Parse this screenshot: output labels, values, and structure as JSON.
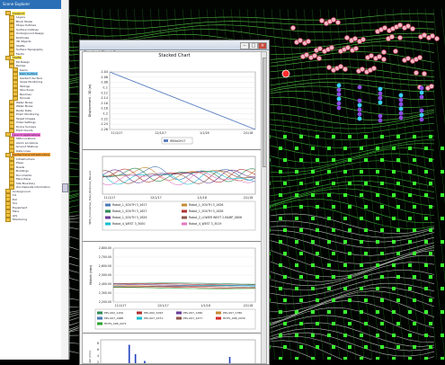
{
  "explorer": {
    "title": "Scene Explorer",
    "items": [
      {
        "label": "Viewport",
        "indent": 1,
        "hl": "#f5e050"
      },
      {
        "label": "Layers",
        "indent": 2
      },
      {
        "label": "Block Model",
        "indent": 2
      },
      {
        "label": "Stope Outlines",
        "indent": 2
      },
      {
        "label": "Surface Outlines",
        "indent": 2
      },
      {
        "label": "Underground Design",
        "indent": 2
      },
      {
        "label": "Drillholes",
        "indent": 2
      },
      {
        "label": "3D Objects",
        "indent": 2
      },
      {
        "label": "Shafts",
        "indent": 2
      },
      {
        "label": "Surface Topography",
        "indent": 2
      },
      {
        "label": "Faults",
        "indent": 2
      },
      {
        "label": "Shafts",
        "indent": 1,
        "hl": "#f5e050"
      },
      {
        "label": "Pit Design",
        "indent": 2
      },
      {
        "label": "Ramps",
        "indent": 2
      },
      {
        "label": "Dams",
        "indent": 3
      },
      {
        "label": "Dam Surface",
        "indent": 3,
        "hl": "#7fd0f5"
      },
      {
        "label": "Geotech Surface",
        "indent": 3
      },
      {
        "label": "Slope Monitoring",
        "indent": 3
      },
      {
        "label": "Tailings",
        "indent": 3
      },
      {
        "label": "Structures",
        "indent": 3
      },
      {
        "label": "Benches",
        "indent": 3
      },
      {
        "label": "Tunnels",
        "indent": 3
      },
      {
        "label": "Water Bores",
        "indent": 2
      },
      {
        "label": "Water Bores",
        "indent": 2
      },
      {
        "label": "Radar Data",
        "indent": 2
      },
      {
        "label": "Prism Monitoring",
        "indent": 2
      },
      {
        "label": "Target Images",
        "indent": 2
      },
      {
        "label": "Video Settings",
        "indent": 2
      },
      {
        "label": "Drone Surveys",
        "indent": 2
      },
      {
        "label": "Point Clouds",
        "indent": 2
      },
      {
        "label": "Launch Applications",
        "indent": 1,
        "hl": "#f06fd8"
      },
      {
        "label": "SMS Locations",
        "indent": 2
      },
      {
        "label": "Alarm Locations",
        "indent": 2
      },
      {
        "label": "Ground Stations",
        "indent": 2
      },
      {
        "label": "Data Lines",
        "indent": 2
      },
      {
        "label": "Geotechnical Infrastructure",
        "indent": 1,
        "hl": "#f5a030"
      },
      {
        "label": "Infrastructure",
        "indent": 2
      },
      {
        "label": "Pipes",
        "indent": 2
      },
      {
        "label": "Roads",
        "indent": 2
      },
      {
        "label": "Buildings",
        "indent": 2
      },
      {
        "label": "Documents",
        "indent": 2
      },
      {
        "label": "Mine Plans",
        "indent": 2
      },
      {
        "label": "Site Boundary",
        "indent": 2
      },
      {
        "label": "Ore Deposits Information",
        "indent": 2
      },
      {
        "label": "Underground",
        "indent": 1
      },
      {
        "label": "Int",
        "indent": 1
      },
      {
        "label": "Ext",
        "indent": 1
      },
      {
        "label": "Scs",
        "indent": 1
      },
      {
        "label": "Equipment",
        "indent": 1
      },
      {
        "label": "Mine",
        "indent": 1
      },
      {
        "label": "GIS",
        "indent": 1
      },
      {
        "label": "Monitoring",
        "indent": 1
      }
    ]
  },
  "chart_window": {
    "title": "Stacked Chart 1",
    "header": "Stacked Chart"
  },
  "chart_data": [
    {
      "type": "line",
      "ylabel": "Displacement - 3D (m)",
      "yticks": [
        "-1.04",
        "-1.06",
        "-1.08",
        "-1.1",
        "-1.12",
        "-1.14",
        "-1.16",
        "-1.18",
        "-1.2",
        "-1.22",
        "-1.24",
        "-1.26"
      ],
      "xticks": [
        "11/1/17",
        "12/1/17",
        "1/1/18",
        "2/1/18"
      ],
      "series": [
        {
          "name": "IRSite2917",
          "color": "#5b7fc4",
          "x": [
            0,
            1
          ],
          "y": [
            -1.03,
            -1.26
          ]
        }
      ],
      "legend": [
        "IRSite2917"
      ]
    },
    {
      "type": "line",
      "ylabel": "SMS_Cumulative_Total_Distance_Moved",
      "xticks": [
        "11/1/17",
        "12/1/17",
        "1/1/18",
        "2/1/18"
      ],
      "legend": [
        {
          "name": "Robot_1_SOUTH 3_1617",
          "color": "#4a7ab5"
        },
        {
          "name": "Robot_1_SOUTH 3_1626",
          "color": "#c78a35"
        },
        {
          "name": "Robot_1_SOUTH 3_1627",
          "color": "#2e8b57"
        },
        {
          "name": "Robot_1_SOUTH 3_1628",
          "color": "#b03030"
        },
        {
          "name": "Robot_1_SOUTH 3_1629",
          "color": "#6a3d9a"
        },
        {
          "name": "Robot_2_LOWER WEST 2-RAMP_0806",
          "color": "#8c564b"
        },
        {
          "name": "Robot_4_WEST 3_3000",
          "color": "#17becf"
        },
        {
          "name": "Robot_4_WEST 3_3019",
          "color": "#e377c2"
        }
      ]
    },
    {
      "type": "line",
      "ylabel": "Historic (mm)",
      "yticks": [
        "2,800.00",
        "2,700.00",
        "2,600.00",
        "2,500.00",
        "2,400.00",
        "2,300.00",
        "2,200.00"
      ],
      "xticks": [
        "11/1/17",
        "12/1/17",
        "1/1/18",
        "2/1/18"
      ],
      "legend": [
        {
          "name": "PPL-002_1100",
          "color": "#2e8b57"
        },
        {
          "name": "PPL-002_1093",
          "color": "#b03030"
        },
        {
          "name": "PPL-007_1280",
          "color": "#6a3d9a"
        },
        {
          "name": "PPL-007_1780",
          "color": "#c78a35"
        },
        {
          "name": "PPL-007_1688",
          "color": "#4a7ab5"
        },
        {
          "name": "PPL-007_1671",
          "color": "#17becf"
        },
        {
          "name": "PPL-007_2477",
          "color": "#8c564b"
        },
        {
          "name": "HDTS_008_2030",
          "color": "#d62728"
        },
        {
          "name": "HDTS_008_2071",
          "color": "#2ca02c"
        }
      ]
    },
    {
      "type": "bar",
      "ylabel": "Rainfall (mm)",
      "yticks": [
        "8",
        "6",
        "4",
        "2"
      ],
      "values_note": "spikes"
    }
  ]
}
